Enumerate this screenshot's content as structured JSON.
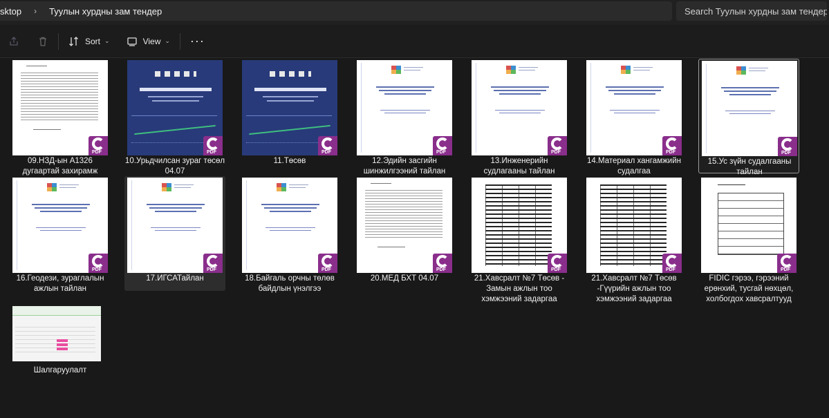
{
  "address": {
    "crumbs": [
      "sktop",
      "Туулын хурдны зам тендер"
    ],
    "separator": "›"
  },
  "search": {
    "placeholder": "Search Туулын хурдны зам тендер"
  },
  "toolbar": {
    "sort_label": "Sort",
    "view_label": "View"
  },
  "files": [
    {
      "name": "09.НЗД-ын А1326 дугаартай захирамж",
      "type": "pdf",
      "thumb": "text"
    },
    {
      "name": "10.Урьдчилсан зураг төсөл 04.07",
      "type": "pdf",
      "thumb": "blue-cover"
    },
    {
      "name": "11.Төсөв",
      "type": "pdf",
      "thumb": "blue-cover"
    },
    {
      "name": "12.Эдийн засгийн шинжилгээний тайлан",
      "type": "pdf",
      "thumb": "doc"
    },
    {
      "name": "13.Инженерийн судлагааны тайлан",
      "type": "pdf",
      "thumb": "doc"
    },
    {
      "name": "14.Материал хангамжийн судалгаа",
      "type": "pdf",
      "thumb": "doc"
    },
    {
      "name": "15.Ус зүйн судалгааны тайлан",
      "type": "pdf",
      "thumb": "doc",
      "state": "focused"
    },
    {
      "name": "16.Геодези, зураглалын ажлын тайлан",
      "type": "pdf",
      "thumb": "doc"
    },
    {
      "name": "17.ИГСАТайлан",
      "type": "pdf",
      "thumb": "doc",
      "state": "selected"
    },
    {
      "name": "18.Байгаль орчны төлөв байдлын үнэлгээ",
      "type": "pdf",
      "thumb": "doc"
    },
    {
      "name": "20.МЕД БХТ 04.07",
      "type": "pdf",
      "thumb": "text"
    },
    {
      "name": "21.Хавсралт №7 Төсөв - Замын ажлын тоо хэмжээний задаргаа",
      "type": "pdf",
      "thumb": "table"
    },
    {
      "name": "21.Хавсралт №7 Төсөв -Гүүрийн ажлын тоо хэмжээний задаргаа",
      "type": "pdf",
      "thumb": "table"
    },
    {
      "name": "FIDIC гэрээ, гэрээний ерөнхий, тусгай нөхцөл, холбогдох хавсралтууд",
      "type": "pdf",
      "thumb": "form"
    },
    {
      "name": "Шалгаруулалт",
      "type": "xlsx",
      "thumb": "sheet"
    }
  ],
  "colors": {
    "pdf_badge": "#8a2e8c",
    "background": "#191919"
  }
}
